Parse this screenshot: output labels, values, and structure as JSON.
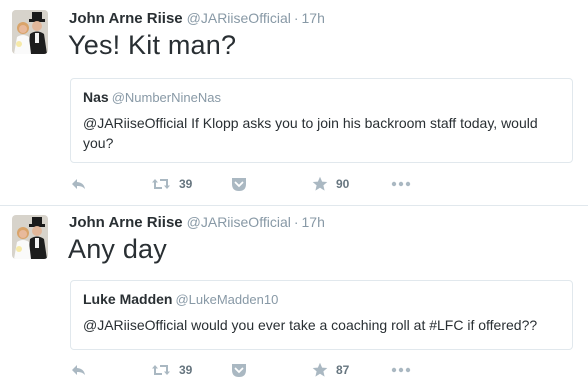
{
  "tweets": [
    {
      "author_name": "John Arne Riise",
      "author_handle": "@JARiiseOfficial",
      "separator": "·",
      "time": "17h",
      "text": "Yes! Kit man?",
      "quoted": {
        "author_name": "Nas",
        "author_handle": "@NumberNineNas",
        "text": "@JARiiseOfficial If Klopp asks you to join his backroom staff today, would you?"
      },
      "actions": {
        "reply_icon": "reply-icon",
        "retweet_icon": "retweet-icon",
        "retweet_count": "39",
        "pocket_icon": "pocket-icon",
        "favorite_icon": "star-icon",
        "favorite_count": "90",
        "more_icon": "more-icon"
      }
    },
    {
      "author_name": "John Arne Riise",
      "author_handle": "@JARiiseOfficial",
      "separator": "·",
      "time": "17h",
      "text": "Any day",
      "quoted": {
        "author_name": "Luke Madden",
        "author_handle": "@LukeMadden10",
        "text": "@JARiiseOfficial would you ever take a coaching roll at #LFC if offered??"
      },
      "actions": {
        "reply_icon": "reply-icon",
        "retweet_icon": "retweet-icon",
        "retweet_count": "39",
        "pocket_icon": "pocket-icon",
        "favorite_icon": "star-icon",
        "favorite_count": "87",
        "more_icon": "more-icon"
      }
    }
  ],
  "colors": {
    "text": "#292f33",
    "muted": "#8899a6",
    "icon": "#aab8c2",
    "border": "#e1e8ed"
  }
}
